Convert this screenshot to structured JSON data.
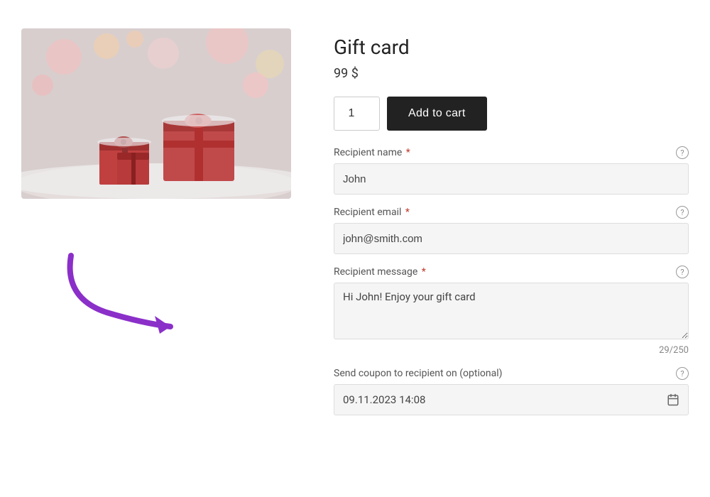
{
  "product": {
    "title": "Gift card",
    "price": "99 $",
    "quantity": "1"
  },
  "buttons": {
    "add_to_cart": "Add to cart"
  },
  "fields": {
    "recipient_name": {
      "label": "Recipient name",
      "required": true,
      "value": "John",
      "placeholder": ""
    },
    "recipient_email": {
      "label": "Recipient email",
      "required": true,
      "value": "john@smith.com",
      "placeholder": ""
    },
    "recipient_message": {
      "label": "Recipient message",
      "required": true,
      "value": "Hi John! Enjoy your gift card",
      "char_count": "29/250"
    },
    "send_coupon": {
      "label": "Send coupon to recipient on (optional)",
      "required": false,
      "value": "09.11.2023 14:08"
    }
  },
  "icons": {
    "help": "?",
    "calendar": "🗓"
  }
}
